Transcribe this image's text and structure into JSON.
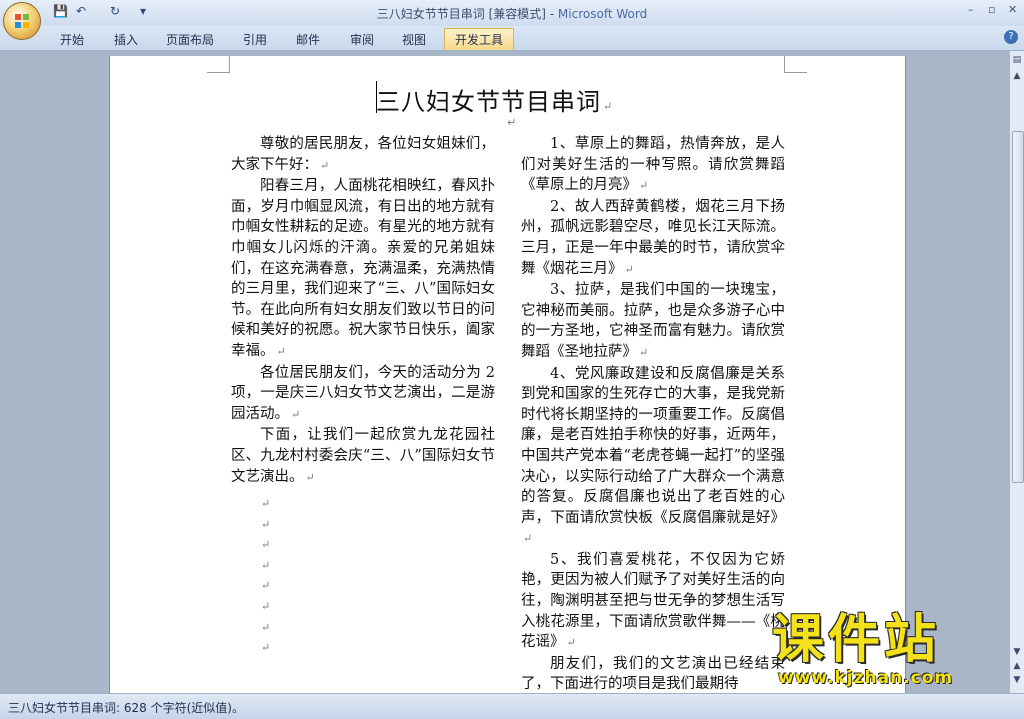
{
  "window": {
    "title": "三八妇女节节目串词 [兼容模式] - ",
    "app": "Microsoft Word",
    "controls": {
      "minimize": "–",
      "restore": "▫",
      "close": "✕"
    }
  },
  "qat": {
    "save": "💾",
    "undo": "↶",
    "redo": "↻",
    "customize": "▾"
  },
  "ribbon": {
    "tabs": [
      "开始",
      "插入",
      "页面布局",
      "引用",
      "邮件",
      "审阅",
      "视图",
      "开发工具"
    ],
    "active_tab": "开发工具",
    "help": "?"
  },
  "document": {
    "title": "三八妇女节节目串词",
    "left_paragraphs": [
      "尊敬的居民朋友，各位妇女姐妹们，大家下午好：",
      "阳春三月，人面桃花相映红，春风扑面，岁月巾帼显风流，有日出的地方就有巾帼女性耕耘的足迹。有星光的地方就有巾帼女儿闪烁的汗滴。亲爱的兄弟姐妹们，在这充满春意，充满温柔，充满热情的三月里，我们迎来了“三、八”国际妇女节。在此向所有妇女朋友们致以节日的问候和美好的祝愿。祝大家节日快乐，阖家幸福。",
      "各位居民朋友们，今天的活动分为 2 项，一是庆三八妇女节文艺演出，二是游园活动。",
      "下面，让我们一起欣赏九龙花园社区、九龙村村委会庆“三、八”国际妇女节文艺演出。"
    ],
    "right_paragraphs": [
      "1、草原上的舞蹈，热情奔放，是人们对美好生活的一种写照。请欣赏舞蹈《草原上的月亮》",
      "2、故人西辞黄鹤楼，烟花三月下扬州，孤帆远影碧空尽，唯见长江天际流。三月，正是一年中最美的时节，请欣赏伞舞《烟花三月》",
      "3、拉萨，是我们中国的一块瑰宝，它神秘而美丽。拉萨，也是众多游子心中的一方圣地，它神圣而富有魅力。请欣赏舞蹈《圣地拉萨》",
      "4、党风廉政建设和反腐倡廉是关系到党和国家的生死存亡的大事，是我党新时代将长期坚持的一项重要工作。反腐倡廉，是老百姓拍手称快的好事，近两年，中国共产党本着“老虎苍蝇一起打”的坚强决心，以实际行动给了广大群众一个满意的答复。反腐倡廉也说出了老百姓的心声，下面请欣赏快板《反腐倡廉就是好》",
      "5、我们喜爱桃花，不仅因为它娇艳，更因为被人们赋予了对美好生活的向往，陶渊明甚至把与世无争的梦想生活写入桃花源里，下面请欣赏歌伴舞——《桃花谣》",
      "朋友们，我们的文艺演出已经结束了，下面进行的项目是我们最期待"
    ],
    "paragraph_mark": "↵"
  },
  "status": {
    "text": "三八妇女节节目串词: 628 个字符(近似值)。"
  },
  "watermark": {
    "chinese": "课件站",
    "url": "www.kjzhan.com"
  }
}
